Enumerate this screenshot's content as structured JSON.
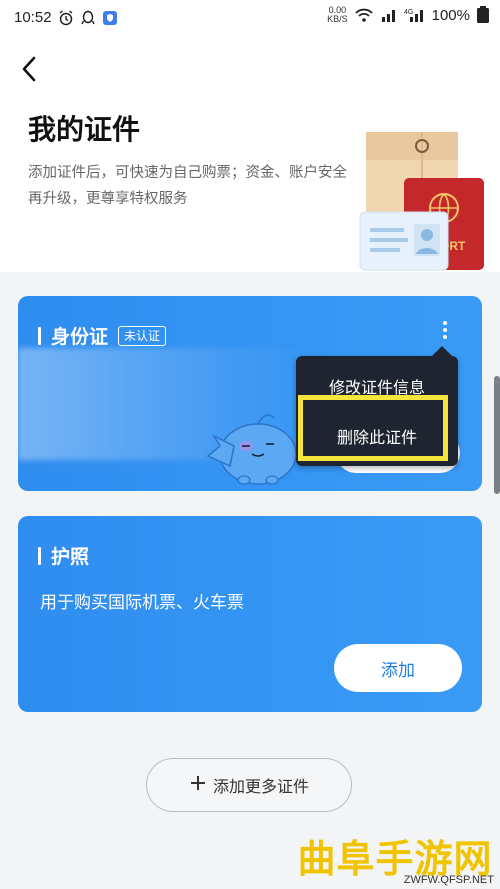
{
  "status_bar": {
    "time": "10:52",
    "net_speed_value": "0.00",
    "net_speed_unit": "KB/S",
    "battery": "100%",
    "icons": [
      "alarm-icon",
      "qq-icon",
      "shield-icon",
      "wifi-icon",
      "signal-icon",
      "signal-4g-icon",
      "battery-icon"
    ]
  },
  "header": {
    "title": "我的证件",
    "subtitle": "添加证件后，可快速为自己购票；资金、账户安全再升级，更尊享特权服务",
    "illustration_label": "ORT"
  },
  "id_card": {
    "title": "身份证",
    "badge": "未认证"
  },
  "context_menu": {
    "edit": "修改证件信息",
    "delete": "删除此证件"
  },
  "passport_card": {
    "title": "护照",
    "description": "用于购买国际机票、火车票",
    "add_button": "添加"
  },
  "add_more": {
    "label": "添加更多证件"
  },
  "watermark": {
    "text": "曲阜手游网",
    "url": "ZWFW.QFSP.NET"
  },
  "colors": {
    "card_blue": "#3a9bf6",
    "menu_dark": "#1f2530",
    "highlight_yellow": "#f5e43a",
    "watermark_yellow": "#f0c400"
  }
}
